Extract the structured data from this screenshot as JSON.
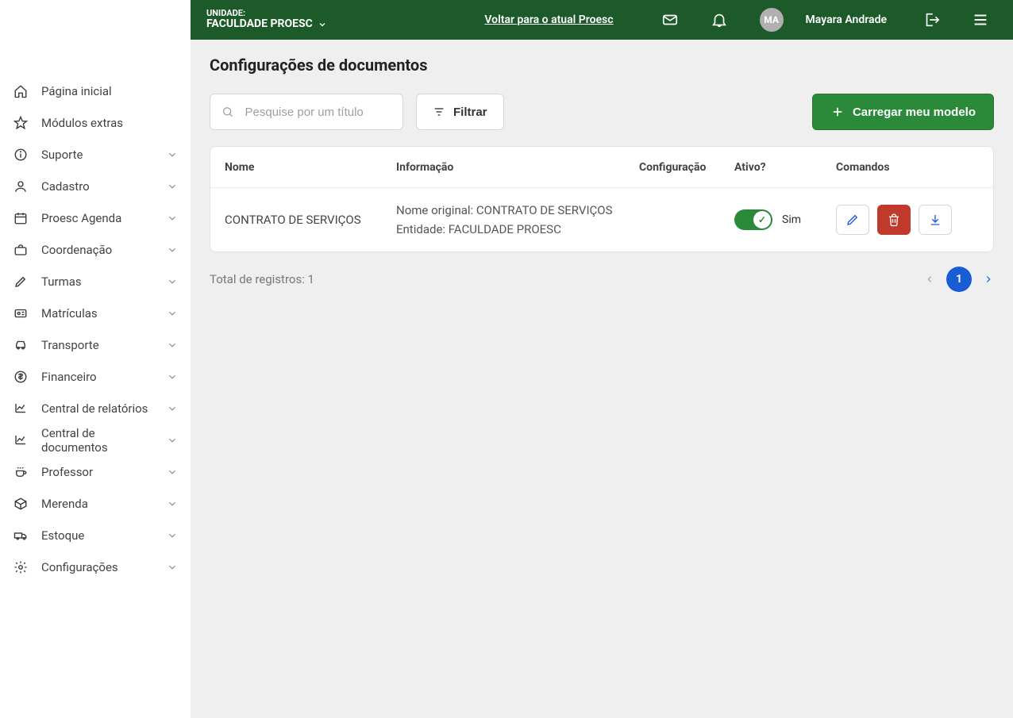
{
  "header": {
    "unit_label": "UNIDADE:",
    "unit_name": "FACULDADE PROESC",
    "back_link": "Voltar para o atual Proesc",
    "avatar_initials": "MA",
    "user_name": "Mayara Andrade"
  },
  "sidebar": {
    "items": [
      {
        "label": "Página inicial",
        "icon": "home",
        "expandable": false
      },
      {
        "label": "Módulos extras",
        "icon": "star",
        "expandable": false
      },
      {
        "label": "Suporte",
        "icon": "info",
        "expandable": true
      },
      {
        "label": "Cadastro",
        "icon": "user",
        "expandable": true
      },
      {
        "label": "Proesc Agenda",
        "icon": "calendar",
        "expandable": true
      },
      {
        "label": "Coordenação",
        "icon": "briefcase",
        "expandable": true
      },
      {
        "label": "Turmas",
        "icon": "pencil",
        "expandable": true
      },
      {
        "label": "Matrículas",
        "icon": "id-card",
        "expandable": true
      },
      {
        "label": "Transporte",
        "icon": "car",
        "expandable": true
      },
      {
        "label": "Financeiro",
        "icon": "dollar",
        "expandable": true
      },
      {
        "label": "Central de relatórios",
        "icon": "chart",
        "expandable": true
      },
      {
        "label": "Central de documentos",
        "icon": "chart",
        "expandable": true
      },
      {
        "label": "Professor",
        "icon": "coffee",
        "expandable": true
      },
      {
        "label": "Merenda",
        "icon": "box",
        "expandable": true
      },
      {
        "label": "Estoque",
        "icon": "truck",
        "expandable": true
      },
      {
        "label": "Configurações",
        "icon": "gear",
        "expandable": true
      }
    ]
  },
  "page": {
    "title": "Configurações de documentos",
    "search_placeholder": "Pesquise por um título",
    "filter_label": "Filtrar",
    "upload_label": "Carregar meu modelo"
  },
  "table": {
    "columns": {
      "nome": "Nome",
      "info": "Informação",
      "configuracao": "Configuração",
      "ativo": "Ativo?",
      "comandos": "Comandos"
    },
    "rows": [
      {
        "nome": "CONTRATO DE SERVIÇOS",
        "info_line1": "Nome original: CONTRATO DE SERVIÇOS",
        "info_line2": "Entidade: FACULDADE PROESC",
        "ativo_text": "Sim",
        "ativo": true
      }
    ]
  },
  "footer": {
    "total_text": "Total de registros: 1",
    "current_page": "1"
  }
}
